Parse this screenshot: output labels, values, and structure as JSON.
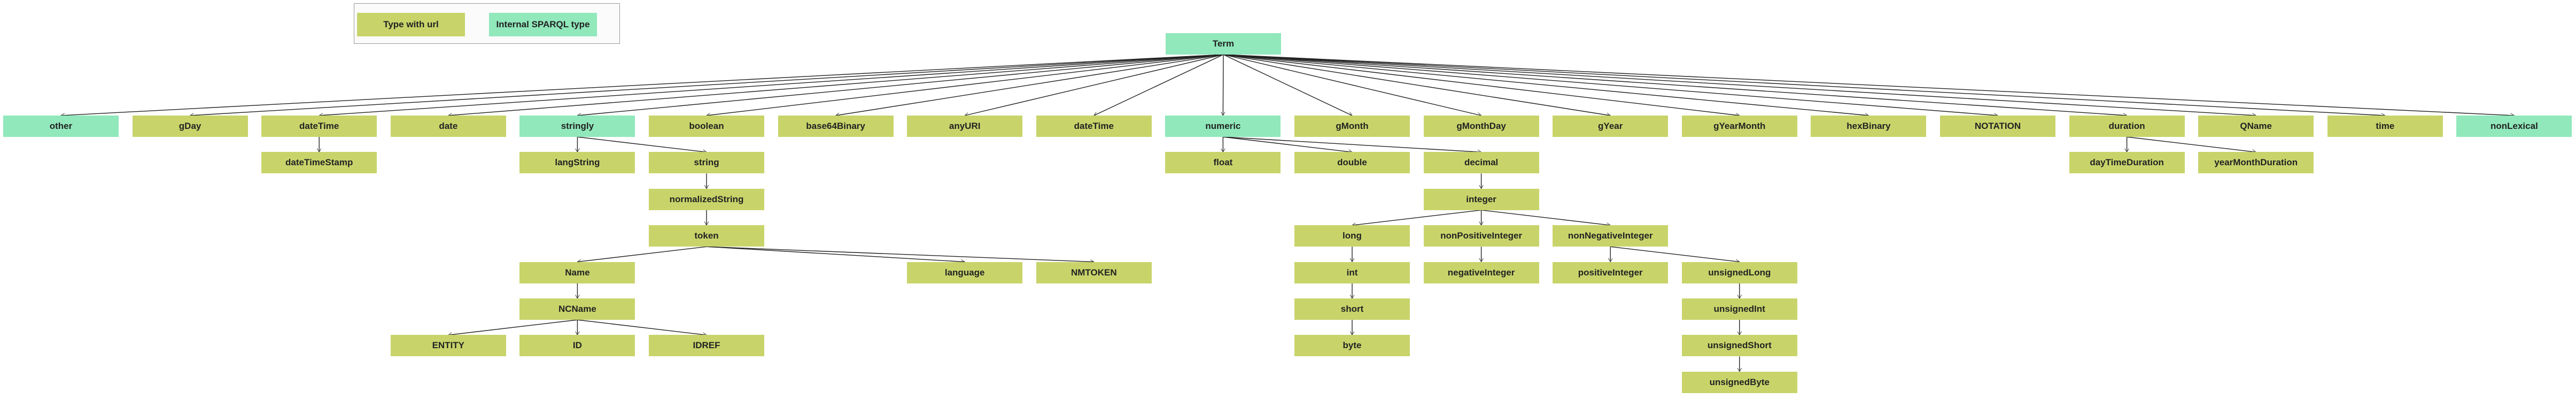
{
  "legend": {
    "type_with_url": "Type with url",
    "internal_type": "Internal SPARQL type"
  },
  "colors": {
    "type_with_url": "#c8d46a",
    "internal_type": "#90e8bb",
    "edge": "#222222"
  },
  "tree": {
    "label": "Term",
    "kind": "internal",
    "children": [
      {
        "label": "other",
        "kind": "internal"
      },
      {
        "label": "gDay",
        "kind": "url"
      },
      {
        "label": "dateTime",
        "kind": "url",
        "children": [
          {
            "label": "dateTimeStamp",
            "kind": "url"
          }
        ]
      },
      {
        "label": "date",
        "kind": "url"
      },
      {
        "label": "stringly",
        "kind": "internal",
        "children": [
          {
            "label": "langString",
            "kind": "url"
          },
          {
            "label": "string",
            "kind": "url",
            "children": [
              {
                "label": "normalizedString",
                "kind": "url",
                "children": [
                  {
                    "label": "token",
                    "kind": "url",
                    "children": [
                      {
                        "label": "Name",
                        "kind": "url",
                        "children": [
                          {
                            "label": "NCName",
                            "kind": "url",
                            "children": [
                              {
                                "label": "ENTITY",
                                "kind": "url"
                              },
                              {
                                "label": "ID",
                                "kind": "url"
                              },
                              {
                                "label": "IDREF",
                                "kind": "url"
                              }
                            ]
                          }
                        ]
                      },
                      {
                        "label": "language",
                        "kind": "url"
                      },
                      {
                        "label": "NMTOKEN",
                        "kind": "url"
                      }
                    ]
                  }
                ]
              }
            ]
          }
        ]
      },
      {
        "label": "boolean",
        "kind": "url"
      },
      {
        "label": "base64Binary",
        "kind": "url"
      },
      {
        "label": "anyURI",
        "kind": "url"
      },
      {
        "label": "dateTime",
        "kind": "url"
      },
      {
        "label": "numeric",
        "kind": "internal",
        "children": [
          {
            "label": "float",
            "kind": "url"
          },
          {
            "label": "double",
            "kind": "url"
          },
          {
            "label": "decimal",
            "kind": "url",
            "children": [
              {
                "label": "integer",
                "kind": "url",
                "children": [
                  {
                    "label": "long",
                    "kind": "url",
                    "children": [
                      {
                        "label": "int",
                        "kind": "url",
                        "children": [
                          {
                            "label": "short",
                            "kind": "url",
                            "children": [
                              {
                                "label": "byte",
                                "kind": "url"
                              }
                            ]
                          }
                        ]
                      }
                    ]
                  },
                  {
                    "label": "nonPositiveInteger",
                    "kind": "url",
                    "children": [
                      {
                        "label": "negativeInteger",
                        "kind": "url"
                      }
                    ]
                  },
                  {
                    "label": "nonNegativeInteger",
                    "kind": "url",
                    "children": [
                      {
                        "label": "positiveInteger",
                        "kind": "url"
                      },
                      {
                        "label": "unsignedLong",
                        "kind": "url",
                        "children": [
                          {
                            "label": "unsignedInt",
                            "kind": "url",
                            "children": [
                              {
                                "label": "unsignedShort",
                                "kind": "url",
                                "children": [
                                  {
                                    "label": "unsignedByte",
                                    "kind": "url"
                                  }
                                ]
                              }
                            ]
                          }
                        ]
                      }
                    ]
                  }
                ]
              }
            ]
          }
        ]
      },
      {
        "label": "gMonth",
        "kind": "url"
      },
      {
        "label": "gMonthDay",
        "kind": "url"
      },
      {
        "label": "gYear",
        "kind": "url"
      },
      {
        "label": "gYearMonth",
        "kind": "url"
      },
      {
        "label": "hexBinary",
        "kind": "url"
      },
      {
        "label": "NOTATION",
        "kind": "url"
      },
      {
        "label": "duration",
        "kind": "url",
        "children": [
          {
            "label": "dayTimeDuration",
            "kind": "url"
          },
          {
            "label": "yearMonthDuration",
            "kind": "url"
          }
        ]
      },
      {
        "label": "QName",
        "kind": "url"
      },
      {
        "label": "time",
        "kind": "url"
      },
      {
        "label": "nonLexical",
        "kind": "internal"
      }
    ]
  }
}
